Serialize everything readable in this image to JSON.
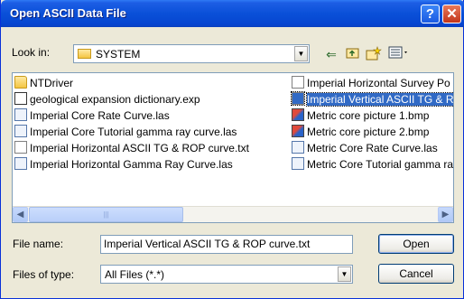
{
  "dialog": {
    "title": "Open ASCII Data File",
    "help_icon": "question-mark-icon",
    "close_icon": "close-icon"
  },
  "lookin": {
    "label": "Look in:",
    "value": "SYSTEM",
    "icon": "folder-icon"
  },
  "toolbar": {
    "back_icon": "back-arrow-icon",
    "up_icon": "up-one-level-icon",
    "new_folder_icon": "new-folder-icon",
    "view_menu_icon": "view-menu-icon"
  },
  "files": {
    "column1": [
      {
        "name": "NTDriver",
        "icon": "folder"
      },
      {
        "name": "geological expansion dictionary.exp",
        "icon": "exp"
      },
      {
        "name": "Imperial Core Rate Curve.las",
        "icon": "doclas"
      },
      {
        "name": "Imperial Core Tutorial gamma ray curve.las",
        "icon": "doclas"
      },
      {
        "name": "Imperial Horizontal ASCII TG & ROP curve.txt",
        "icon": "txt"
      },
      {
        "name": "Imperial Horizontal Gamma Ray Curve.las",
        "icon": "doclas"
      }
    ],
    "column2": [
      {
        "name": "Imperial Horizontal Survey Po",
        "icon": "txt"
      },
      {
        "name": "Imperial Vertical ASCII TG & R",
        "icon": "txt",
        "selected": true
      },
      {
        "name": "Metric core picture 1.bmp",
        "icon": "bmp"
      },
      {
        "name": "Metric core picture 2.bmp",
        "icon": "bmp"
      },
      {
        "name": "Metric Core Rate Curve.las",
        "icon": "doclas"
      },
      {
        "name": "Metric Core Tutorial gamma ra",
        "icon": "doclas"
      }
    ]
  },
  "filename": {
    "label": "File name:",
    "value": "Imperial Vertical ASCII TG & ROP curve.txt"
  },
  "filetype": {
    "label": "Files of type:",
    "value": "All Files (*.*)"
  },
  "buttons": {
    "open": "Open",
    "cancel": "Cancel"
  }
}
